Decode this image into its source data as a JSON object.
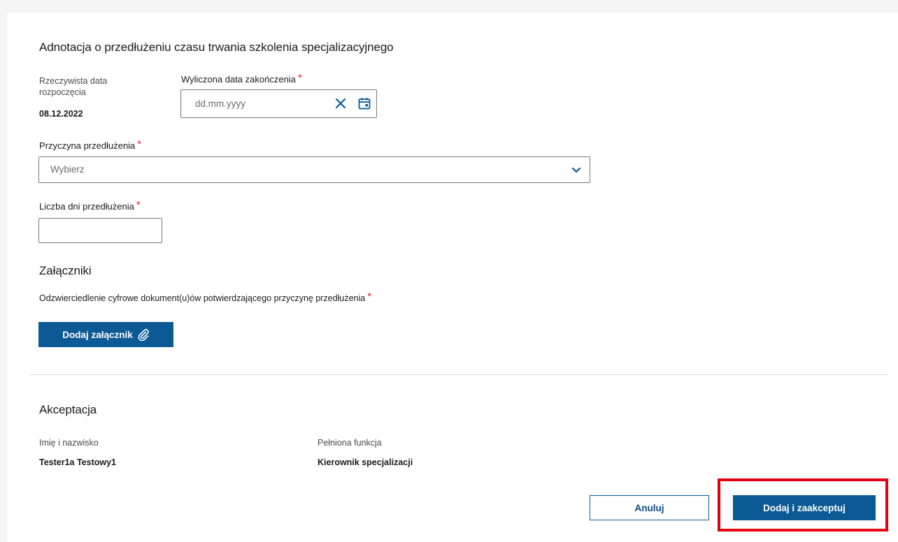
{
  "extension": {
    "title": "Adnotacja o przedłużeniu czasu trwania szkolenia specjalizacyjnego",
    "start_label_line1": "Rzeczywista data",
    "start_label_line2": "rozpoczęcia",
    "start_value": "08.12.2022",
    "end_date_label": "Wyliczona data zakończenia",
    "end_date_placeholder": "dd.mm.yyyy",
    "end_date_value": "",
    "reason_label": "Przyczyna przedłużenia",
    "reason_selected": "Wybierz",
    "days_label": "Liczba dni przedłużenia",
    "days_value": "",
    "required_mark": "*"
  },
  "attachments": {
    "title": "Załączniki",
    "description": "Odzwierciedlenie cyfrowe dokument(u)ów potwierdzającego przyczynę przedłużenia",
    "add_button": "Dodaj załącznik"
  },
  "acceptance": {
    "title": "Akceptacja",
    "name_label": "Imię i nazwisko",
    "name_value": "Tester1a Testowy1",
    "function_label": "Pełniona funkcja",
    "function_value": "Kierownik specjalizacji"
  },
  "actions": {
    "cancel": "Anuluj",
    "submit": "Dodaj i zaakceptuj"
  },
  "icons": {
    "clear": "close-icon",
    "calendar": "calendar-icon",
    "dropdown": "chevron-down-icon",
    "attachment": "paperclip-icon"
  },
  "colors": {
    "primary": "#0b5a96",
    "required": "#d8262f",
    "highlight": "#e3000f"
  }
}
